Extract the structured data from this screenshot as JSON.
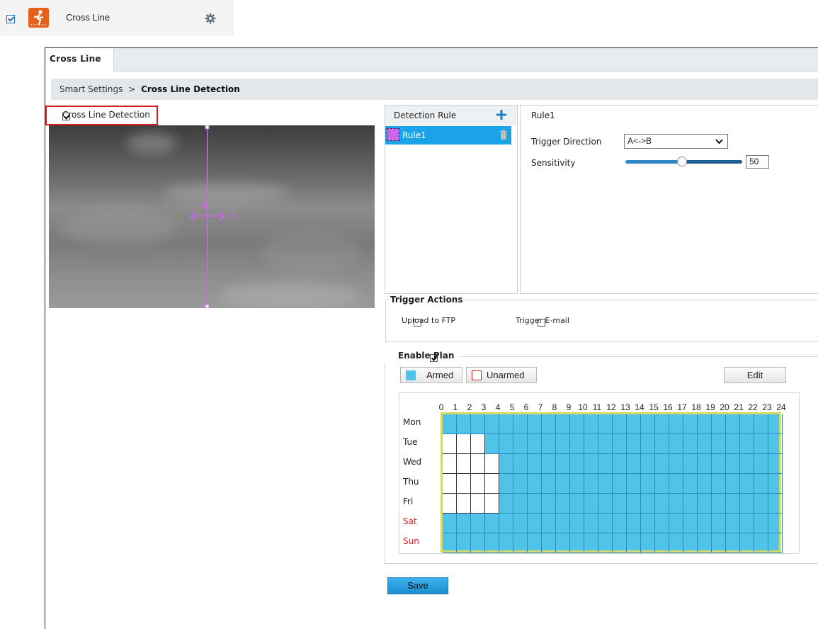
{
  "header": {
    "feature_label": "Cross Line",
    "enabled": true
  },
  "tabs": [
    {
      "label": "Cross Line",
      "active": true
    }
  ],
  "breadcrumb": {
    "parent": "Smart Settings",
    "separator": ">",
    "current": "Cross Line Detection"
  },
  "detection_toggle": {
    "label": "Cross Line Detection",
    "checked": true
  },
  "video": {
    "line_label_a": "A",
    "line_label_b": "B"
  },
  "rules": {
    "header": "Detection Rule",
    "items": [
      {
        "name": "Rule1",
        "color": "#cc66ee",
        "selected": true
      }
    ]
  },
  "rule_config": {
    "title": "Rule1",
    "trigger_direction_label": "Trigger Direction",
    "trigger_direction_value": "A<->B",
    "sensitivity_label": "Sensitivity",
    "sensitivity_value": "50"
  },
  "trigger_actions": {
    "legend": "Trigger Actions",
    "items": [
      {
        "label": "Upload to FTP",
        "checked": false
      },
      {
        "label": "Trigger E-mail",
        "checked": false
      }
    ]
  },
  "plan": {
    "legend": "Enable Plan",
    "enabled": true,
    "armed_label": "Armed",
    "unarmed_label": "Unarmed",
    "edit_label": "Edit",
    "hours": [
      "0",
      "1",
      "2",
      "3",
      "4",
      "5",
      "6",
      "7",
      "8",
      "9",
      "10",
      "11",
      "12",
      "13",
      "14",
      "15",
      "16",
      "17",
      "18",
      "19",
      "20",
      "21",
      "22",
      "23",
      "24"
    ],
    "days": [
      {
        "label": "Mon",
        "weekend": false,
        "unarmed_hours": 0
      },
      {
        "label": "Tue",
        "weekend": false,
        "unarmed_hours": 3
      },
      {
        "label": "Wed",
        "weekend": false,
        "unarmed_hours": 4
      },
      {
        "label": "Thu",
        "weekend": false,
        "unarmed_hours": 4
      },
      {
        "label": "Fri",
        "weekend": false,
        "unarmed_hours": 4
      },
      {
        "label": "Sat",
        "weekend": true,
        "unarmed_hours": 0
      },
      {
        "label": "Sun",
        "weekend": true,
        "unarmed_hours": 0
      }
    ]
  },
  "save_label": "Save",
  "colors": {
    "accent": "#1aa3e8",
    "armed": "#4fc3e8",
    "weekend": "#e02020",
    "rule_line": "#cc66ee",
    "feature_icon": "#e8601c"
  }
}
